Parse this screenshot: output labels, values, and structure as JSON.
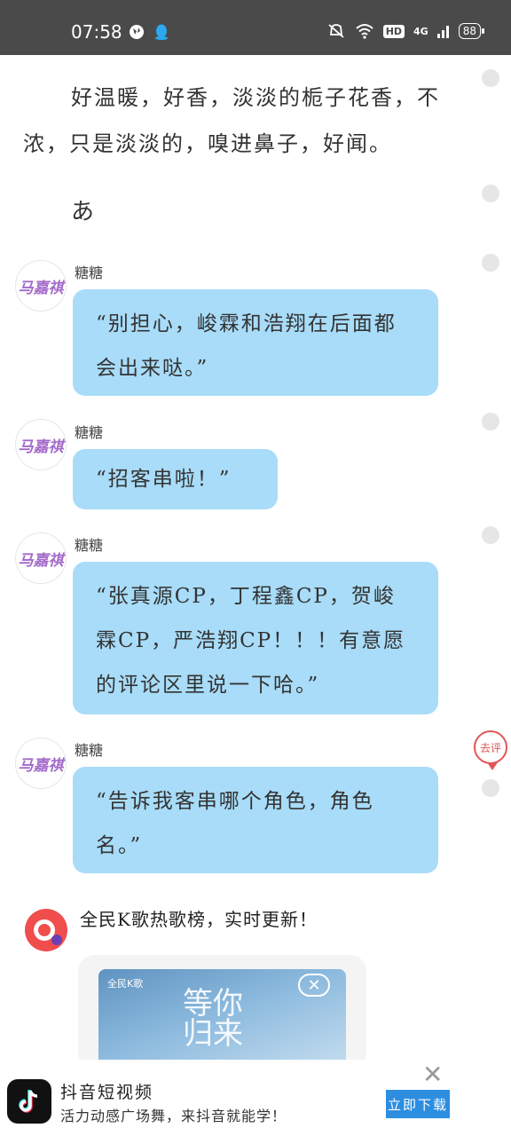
{
  "status_bar": {
    "time": "07:58",
    "hd": "HD",
    "network": "4G",
    "battery": "88"
  },
  "story": {
    "paragraph_line1": "好温暖，好香，淡淡的栀子花香，不",
    "paragraph_line2": "浓，只是淡淡的，嗅进鼻子，好闻。",
    "character_line": "あ"
  },
  "messages": [
    {
      "speaker": "糖糖",
      "avatar_text": "马嘉祺",
      "text": "“别担心，峻霖和浩翔在后面都会出来哒。”"
    },
    {
      "speaker": "糖糖",
      "avatar_text": "马嘉祺",
      "text": "“招客串啦！”"
    },
    {
      "speaker": "糖糖",
      "avatar_text": "马嘉祺",
      "text": "“张真源CP，丁程鑫CP，贺峻霖CP，严浩翔CP！！！有意愿的评论区里说一下哈。”"
    },
    {
      "speaker": "糖糖",
      "avatar_text": "马嘉祺",
      "text": "“告诉我客串哪个角色，角色名。”"
    }
  ],
  "comment_badge": "去评",
  "ad": {
    "title": "全民K歌热歌榜，实时更新！",
    "image_brand": "全民K歌",
    "image_text": "等你归来",
    "close_symbol": "✕"
  },
  "bottom_banner": {
    "title": "抖音短视频",
    "subtitle": "活力动感广场舞，来抖音就能学！",
    "button": "立即下载",
    "close_symbol": "✕"
  }
}
